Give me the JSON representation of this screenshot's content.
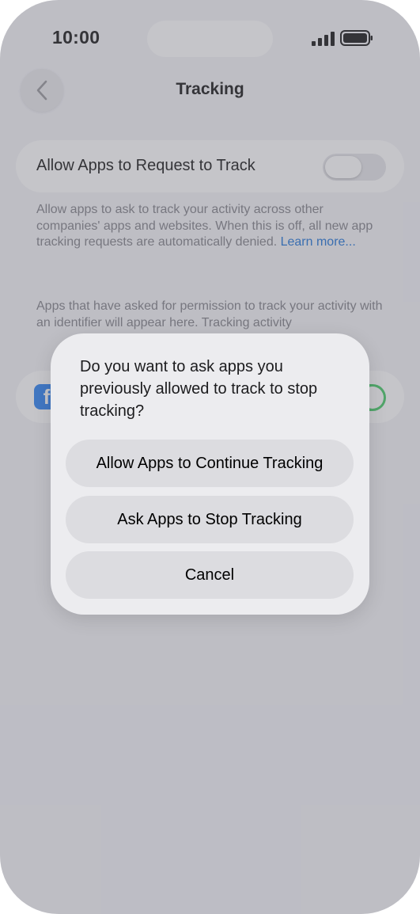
{
  "status_bar": {
    "time": "10:00"
  },
  "nav": {
    "title": "Tracking",
    "back_icon": "chevron-left-icon"
  },
  "settings": {
    "toggle_label": "Allow Apps to Request to Track",
    "toggle_on": false,
    "footnote_text": "Allow apps to ask to track your activity across other companies' apps and websites. When this is off, all new app tracking requests are automatically denied. ",
    "footnote_link": "Learn more...",
    "apps_note": "Apps that have asked for permission to track your activity with an identifier will appear here. Tracking activity",
    "app_icon": "facebook-icon",
    "app_toggle_on": true
  },
  "alert": {
    "message": "Do you want to ask apps you previously allowed to track to stop tracking?",
    "buttons": [
      {
        "label": "Allow Apps to Continue Tracking"
      },
      {
        "label": "Ask Apps to Stop Tracking"
      },
      {
        "label": "Cancel"
      }
    ]
  },
  "colors": {
    "link": "#0a66d4",
    "switch_on": "#34c759",
    "app_icon_bg": "#1877f2"
  }
}
